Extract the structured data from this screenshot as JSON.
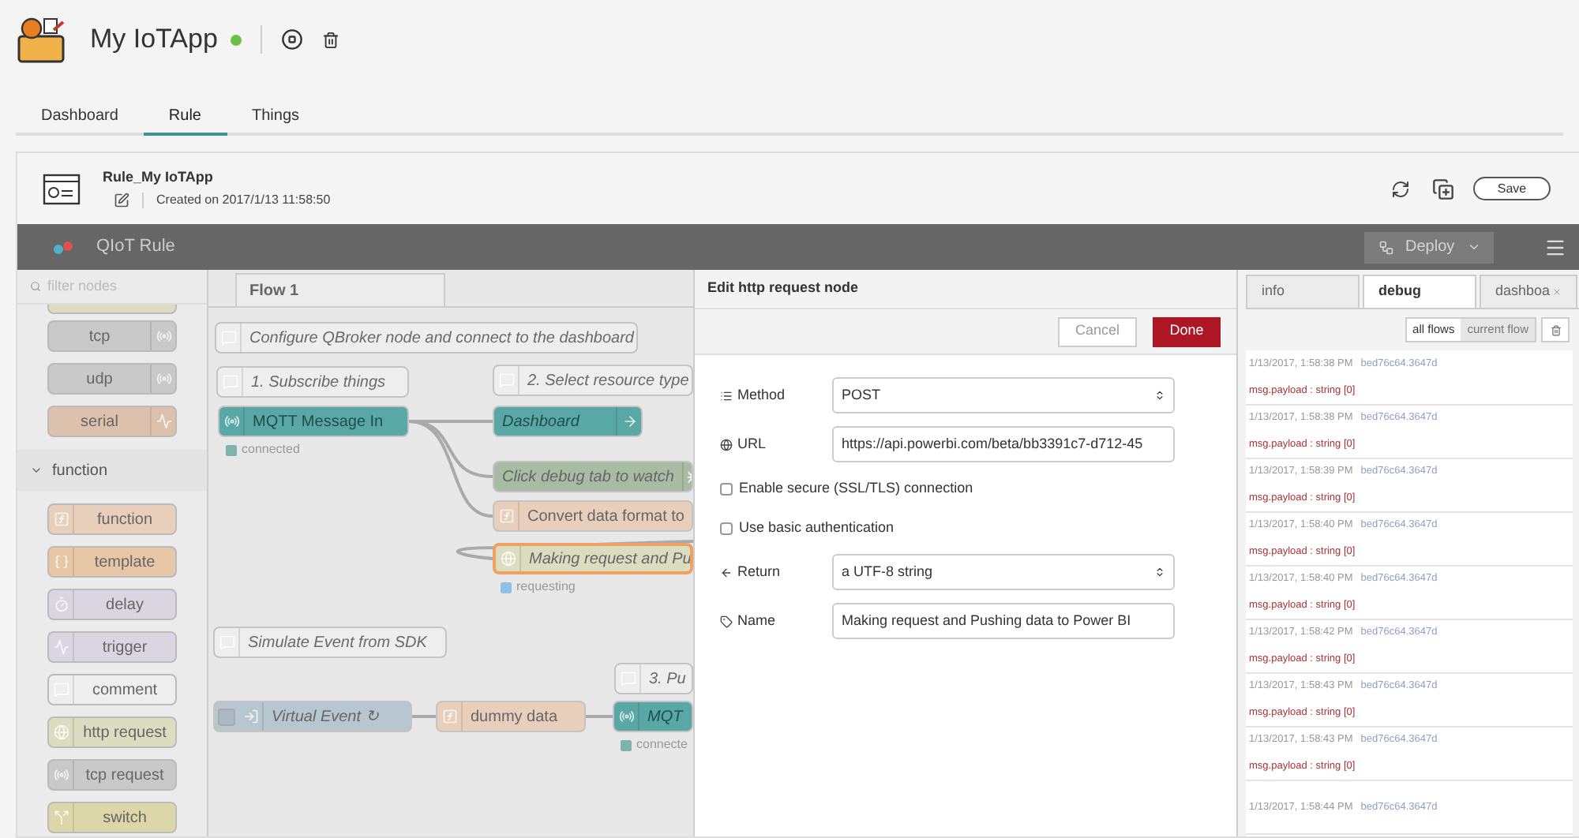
{
  "app": {
    "title": "My IoTApp",
    "running": true
  },
  "tabs": [
    {
      "label": "Dashboard",
      "selected": false
    },
    {
      "label": "Rule",
      "selected": true
    },
    {
      "label": "Things",
      "selected": false
    }
  ],
  "rule": {
    "title": "Rule_My IoTApp",
    "created": "Created on 2017/1/13 11:58:50",
    "save": "Save"
  },
  "editor": {
    "title": "QIoT Rule",
    "deploy": "Deploy",
    "deploy_disabled": true
  },
  "palette": {
    "filter_placeholder": "filter nodes",
    "nodes": [
      {
        "label": "tcp",
        "kind": "net-out",
        "color": "#c9c9c9"
      },
      {
        "label": "udp",
        "kind": "net-out",
        "color": "#c9c9c9"
      },
      {
        "label": "serial",
        "kind": "serial-out",
        "color": "#dcc2ad"
      }
    ],
    "category": {
      "label": "function",
      "expanded": true
    },
    "category_nodes": [
      {
        "label": "function",
        "kind": "function",
        "color": "#e8cfbb"
      },
      {
        "label": "template",
        "kind": "template",
        "color": "#e6c7a6"
      },
      {
        "label": "delay",
        "kind": "delay",
        "color": "#d9d6e2"
      },
      {
        "label": "trigger",
        "kind": "trigger",
        "color": "#d9d6e2"
      },
      {
        "label": "comment",
        "kind": "comment",
        "color": "#eeeeee"
      },
      {
        "label": "http request",
        "kind": "http",
        "color": "#dcdcc0"
      },
      {
        "label": "tcp request",
        "kind": "net",
        "color": "#c9c9c9"
      },
      {
        "label": "switch",
        "kind": "switch",
        "color": "#dcd7a8"
      }
    ]
  },
  "flow": {
    "tab": "Flow 1",
    "nodes": [
      {
        "label": "Configure QBroker node and connect to the dashboard",
        "kind": "comment",
        "color": "#eeeeee",
        "italic": true,
        "selected": false
      },
      {
        "label": "1. Subscribe things",
        "kind": "comment",
        "color": "#eeeeee",
        "italic": true,
        "selected": false
      },
      {
        "label": "2. Select resource type",
        "kind": "comment",
        "color": "#eeeeee",
        "italic": true,
        "selected": false
      },
      {
        "label": "MQTT Message In",
        "kind": "mqtt-in",
        "color": "#5aa8a5",
        "italic": false,
        "selected": false,
        "status": {
          "text": "connected",
          "color": "#7fb3ad"
        }
      },
      {
        "label": "Dashboard",
        "kind": "dashboard",
        "color": "#5aa8a5",
        "italic": true,
        "selected": false
      },
      {
        "label": "Click debug tab to watch",
        "kind": "debug",
        "color": "#a8bca4",
        "italic": true,
        "selected": false
      },
      {
        "label": "Convert data format to",
        "kind": "function",
        "color": "#e8cfbb",
        "italic": false,
        "selected": false
      },
      {
        "label": "Making request and Pu",
        "kind": "http",
        "color": "#dcdcc0",
        "italic": true,
        "selected": true,
        "status": {
          "text": "requesting",
          "color": "#8fc0e3"
        }
      },
      {
        "label": "Simulate Event from SDK",
        "kind": "comment",
        "color": "#eeeeee",
        "italic": true,
        "selected": false
      },
      {
        "label": "3. Pu",
        "kind": "comment",
        "color": "#eeeeee",
        "italic": true,
        "selected": false
      },
      {
        "label": "Virtual Event ↻",
        "kind": "inject",
        "color": "#b8c6d0",
        "italic": true,
        "selected": false
      },
      {
        "label": "dummy data",
        "kind": "function",
        "color": "#e8cfbb",
        "italic": false,
        "selected": false
      },
      {
        "label": "MQT",
        "kind": "mqtt-out",
        "color": "#5aa8a5",
        "italic": true,
        "selected": false,
        "status": {
          "text": "connecte",
          "color": "#7fb3ad"
        }
      }
    ]
  },
  "tray": {
    "title": "Edit http request node",
    "cancel": "Cancel",
    "done": "Done",
    "fields": [
      {
        "kind": "select",
        "label": "Method",
        "value": "POST"
      },
      {
        "kind": "text",
        "label": "URL",
        "value": "https://api.powerbi.com/beta/bb3391c7-d712-45"
      },
      {
        "kind": "checkbox",
        "label": "Enable secure (SSL/TLS) connection",
        "checked": false
      },
      {
        "kind": "checkbox",
        "label": "Use basic authentication",
        "checked": false
      },
      {
        "kind": "select",
        "label": "Return",
        "value": "a UTF-8 string"
      },
      {
        "kind": "text",
        "label": "Name",
        "value": "Making request and Pushing data to Power BI"
      }
    ]
  },
  "sidebar": {
    "tabs": [
      {
        "label": "info",
        "selected": false,
        "closable": false
      },
      {
        "label": "debug",
        "selected": true,
        "closable": false
      },
      {
        "label": "dashboa",
        "selected": false,
        "closable": true
      }
    ],
    "filters": [
      {
        "label": "all flows",
        "selected": true
      },
      {
        "label": "current flow",
        "selected": false
      }
    ],
    "messages": [
      {
        "time": "1/13/2017, 1:58:38 PM",
        "node": "bed76c64.3647d",
        "payload": "msg.payload : string [0]"
      },
      {
        "time": "1/13/2017, 1:58:38 PM",
        "node": "bed76c64.3647d",
        "payload": "msg.payload : string [0]"
      },
      {
        "time": "1/13/2017, 1:58:39 PM",
        "node": "bed76c64.3647d",
        "payload": "msg.payload : string [0]"
      },
      {
        "time": "1/13/2017, 1:58:40 PM",
        "node": "bed76c64.3647d",
        "payload": "msg.payload : string [0]"
      },
      {
        "time": "1/13/2017, 1:58:40 PM",
        "node": "bed76c64.3647d",
        "payload": "msg.payload : string [0]"
      },
      {
        "time": "1/13/2017, 1:58:42 PM",
        "node": "bed76c64.3647d",
        "payload": "msg.payload : string [0]"
      },
      {
        "time": "1/13/2017, 1:58:43 PM",
        "node": "bed76c64.3647d",
        "payload": "msg.payload : string [0]"
      },
      {
        "time": "1/13/2017, 1:58:43 PM",
        "node": "bed76c64.3647d",
        "payload": "msg.payload : string [0]"
      },
      {
        "time": "1/13/2017, 1:58:44 PM",
        "node": "bed76c64.3647d"
      }
    ]
  }
}
